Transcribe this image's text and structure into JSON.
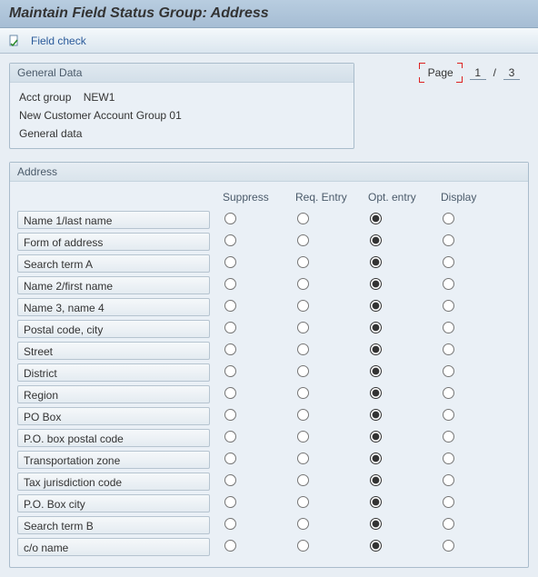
{
  "title": "Maintain Field Status Group: Address",
  "toolbar": {
    "fieldCheck": "Field check"
  },
  "page": {
    "label": "Page",
    "current": "1",
    "sep": "/",
    "total": "3"
  },
  "general": {
    "title": "General Data",
    "acctGroupLabel": "Acct group",
    "acctGroupValue": "NEW1",
    "line2": "New Customer Account Group 01",
    "line3": "General data"
  },
  "address": {
    "title": "Address",
    "columns": [
      "Suppress",
      "Req. Entry",
      "Opt. entry",
      "Display"
    ],
    "rows": [
      {
        "label": "Name 1/last name",
        "selected": 2
      },
      {
        "label": "Form of address",
        "selected": 2
      },
      {
        "label": "Search term A",
        "selected": 2
      },
      {
        "label": "Name 2/first name",
        "selected": 2
      },
      {
        "label": "Name 3, name 4",
        "selected": 2
      },
      {
        "label": "Postal code, city",
        "selected": 2
      },
      {
        "label": "Street",
        "selected": 2
      },
      {
        "label": "District",
        "selected": 2
      },
      {
        "label": "Region",
        "selected": 2
      },
      {
        "label": "PO Box",
        "selected": 2
      },
      {
        "label": "P.O. box postal code",
        "selected": 2
      },
      {
        "label": "Transportation zone",
        "selected": 2
      },
      {
        "label": "Tax jurisdiction code",
        "selected": 2
      },
      {
        "label": "P.O. Box city",
        "selected": 2
      },
      {
        "label": "Search term B",
        "selected": 2
      },
      {
        "label": "c/o name",
        "selected": 2
      }
    ]
  }
}
